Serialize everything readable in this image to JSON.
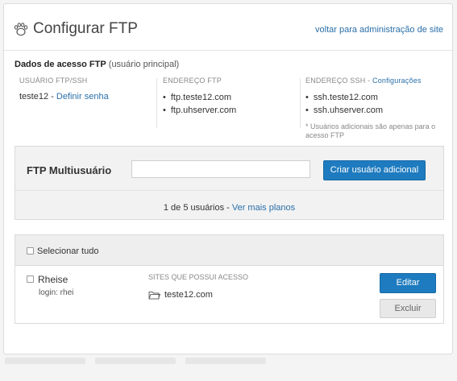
{
  "header": {
    "title": "Configurar FTP",
    "back_link": "voltar para administração de site"
  },
  "access": {
    "heading": "Dados de acesso FTP",
    "heading_sub": "(usuário principal)",
    "user_col": {
      "label": "USUÁRIO FTP/SSH",
      "username": "teste12",
      "separator": " - ",
      "set_password_link": "Definir senha"
    },
    "ftp_col": {
      "label": "ENDEREÇO FTP",
      "addresses": [
        "ftp.teste12.com",
        "ftp.uhserver.com"
      ]
    },
    "ssh_col": {
      "label": "ENDEREÇO SSH",
      "separator": " - ",
      "config_link": "Configurações",
      "addresses": [
        "ssh.teste12.com",
        "ssh.uhserver.com"
      ],
      "note": "* Usuários adicionais são apenas para o acesso FTP"
    }
  },
  "multiuser": {
    "title": "FTP Multiusuário",
    "search_value": "",
    "create_button": "Criar usuário adicional",
    "count_text": "1 de 5 usuários",
    "count_separator": " - ",
    "more_plans_link": "Ver mais planos"
  },
  "users_list": {
    "select_all_label": "Selecionar tudo",
    "sites_label": "SITES QUE POSSUI ACESSO",
    "edit_button": "Editar",
    "delete_button": "Excluir",
    "users": [
      {
        "name": "Rheise",
        "login": "login: rhei",
        "site": "teste12.com"
      }
    ]
  },
  "colors": {
    "accent": "#1e7bbf",
    "link": "#2a6fa8",
    "panel_bg": "#f2f2f2"
  },
  "icons": {
    "title": "paw-icon",
    "search": "search-icon",
    "site": "folder-icon"
  }
}
